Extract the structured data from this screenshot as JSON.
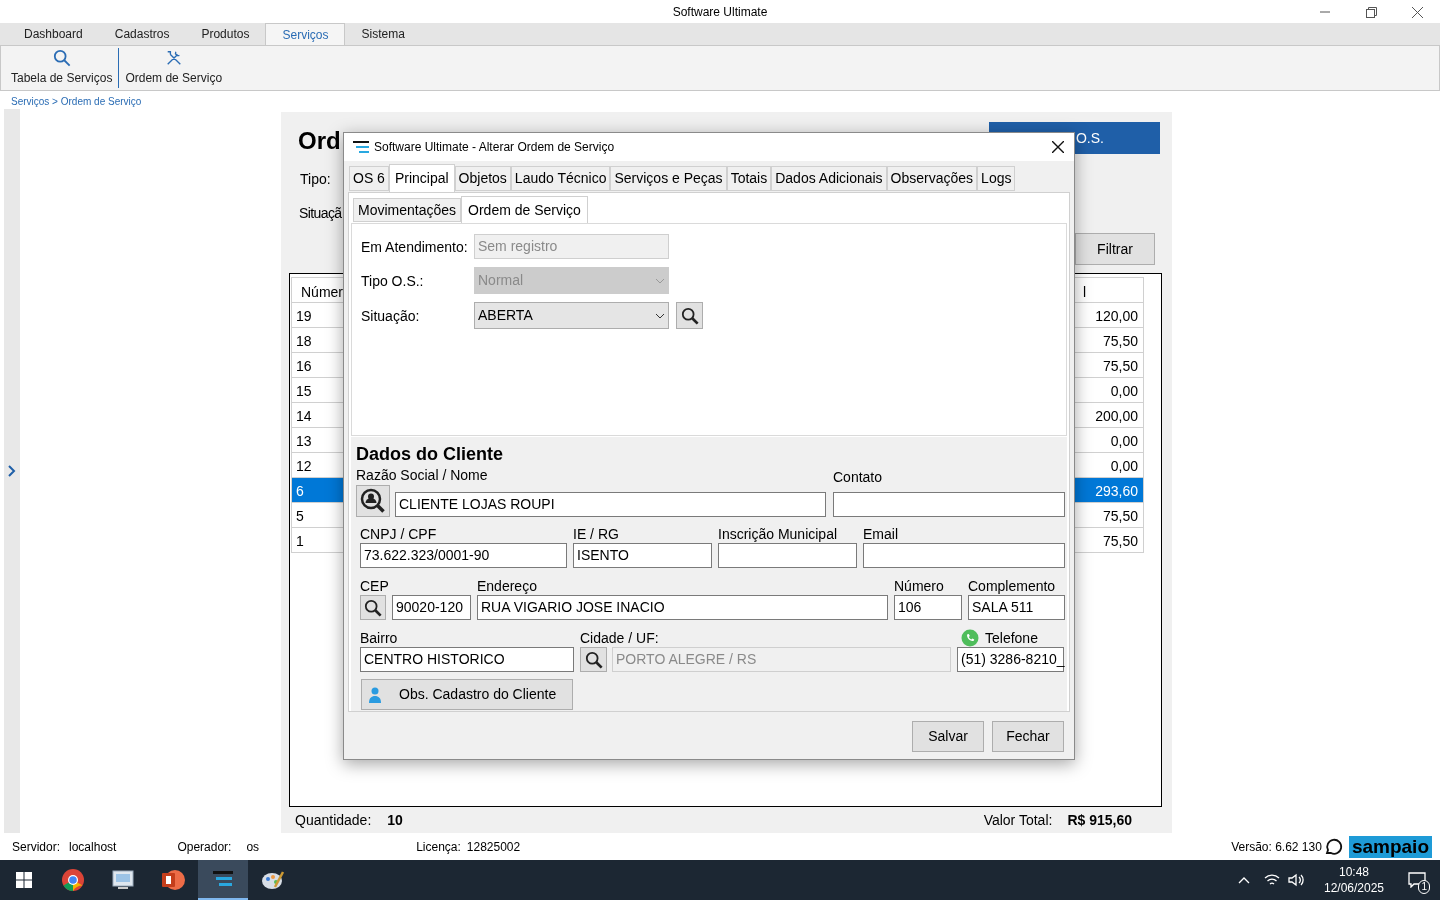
{
  "window": {
    "title": "Software Ultimate"
  },
  "menu_tabs": [
    {
      "label": "Dashboard",
      "selected": false
    },
    {
      "label": "Cadastros",
      "selected": false
    },
    {
      "label": "Produtos",
      "selected": false
    },
    {
      "label": "Serviços",
      "selected": true
    },
    {
      "label": "Sistema",
      "selected": false
    }
  ],
  "ribbon": [
    {
      "label": "Tabela de Serviços",
      "kind": "search"
    },
    {
      "label": "Ordem de Serviço",
      "kind": "tools"
    }
  ],
  "breadcrumb": "Serviços > Ordem de Serviço",
  "background_panel": {
    "title": "Ord",
    "action_button": "O.S.",
    "tipo_label": "Tipo:",
    "situacao_label": "Situaçã",
    "filter_button": "Filtrar",
    "table": {
      "columns": [
        "Númer",
        "l"
      ],
      "rows": [
        {
          "number": "19",
          "value": "120,00",
          "selected": false
        },
        {
          "number": "18",
          "value": "75,50",
          "selected": false
        },
        {
          "number": "16",
          "value": "75,50",
          "selected": false
        },
        {
          "number": "15",
          "value": "0,00",
          "selected": false
        },
        {
          "number": "14",
          "value": "200,00",
          "selected": false
        },
        {
          "number": "13",
          "value": "0,00",
          "selected": false
        },
        {
          "number": "12",
          "value": "0,00",
          "selected": false
        },
        {
          "number": "6",
          "value": "293,60",
          "selected": true
        },
        {
          "number": "5",
          "value": "75,50",
          "selected": false
        },
        {
          "number": "1",
          "value": "75,50",
          "selected": false
        }
      ]
    },
    "quantity_label": "Quantidade:",
    "quantity": "10",
    "total_label": "Valor Total:",
    "total": "R$ 915,60"
  },
  "dialog": {
    "title": "Software Ultimate - Alterar Ordem de Serviço",
    "tabs": [
      {
        "label": "OS 6",
        "selected": false
      },
      {
        "label": "Principal",
        "selected": true
      },
      {
        "label": "Objetos",
        "selected": false
      },
      {
        "label": "Laudo Técnico",
        "selected": false
      },
      {
        "label": "Serviços e Peças",
        "selected": false
      },
      {
        "label": "Totais",
        "selected": false
      },
      {
        "label": "Dados Adicionais",
        "selected": false
      },
      {
        "label": "Observações",
        "selected": false
      },
      {
        "label": "Logs",
        "selected": false
      }
    ],
    "subtabs": [
      {
        "label": "Movimentações",
        "selected": false
      },
      {
        "label": "Ordem de Serviço",
        "selected": true
      }
    ],
    "em_atendimento": {
      "label": "Em Atendimento:",
      "value": "Sem registro",
      "disabled": true
    },
    "tipo_os": {
      "label": "Tipo O.S.:",
      "value": "Normal",
      "disabled": true
    },
    "situacao": {
      "label": "Situação:",
      "value": "ABERTA",
      "disabled": false
    },
    "client": {
      "title": "Dados do Cliente",
      "razao_social": {
        "label": "Razão Social / Nome",
        "value": "CLIENTE LOJAS ROUPI",
        "disabled": false
      },
      "contato": {
        "label": "Contato",
        "disabled": false
      },
      "cnpj": {
        "label": "CNPJ / CPF",
        "value": "73.622.323/0001-90",
        "disabled": false
      },
      "ie_rg": {
        "label": "IE / RG",
        "value": "ISENTO",
        "disabled": false
      },
      "inscricao": {
        "label": "Inscrição Municipal",
        "disabled": false
      },
      "email": {
        "label": "Email",
        "disabled": false
      },
      "cep": {
        "label": "CEP",
        "value": "90020-120",
        "disabled": false
      },
      "endereco": {
        "label": "Endereço",
        "value": "RUA VIGARIO JOSE INACIO",
        "disabled": false
      },
      "numero": {
        "label": "Número",
        "value": "106",
        "disabled": false
      },
      "complemento": {
        "label": "Complemento",
        "value": "SALA 511",
        "disabled": false
      },
      "bairro": {
        "label": "Bairro",
        "value": "CENTRO HISTORICO",
        "disabled": false
      },
      "cidade": {
        "label": "Cidade / UF:",
        "value": "PORTO ALEGRE / RS",
        "disabled": true
      },
      "telefone": {
        "label": "Telefone",
        "value": "(51) 3286-8210_",
        "disabled": false
      },
      "obs_button": "Obs. Cadastro do Cliente"
    },
    "buttons": [
      "Salvar",
      "Fechar"
    ]
  },
  "status_bar": {
    "servidor_label": "Servidor:",
    "servidor": "localhost",
    "operador_label": "Operador:",
    "operador": "os",
    "licenca_label": "Licença:",
    "licenca": "12825002",
    "versao": "Versão: 6.62 130",
    "brand": "sampaio"
  },
  "taskbar": {
    "time": "10:48",
    "date": "12/06/2025",
    "notifications": "1"
  }
}
